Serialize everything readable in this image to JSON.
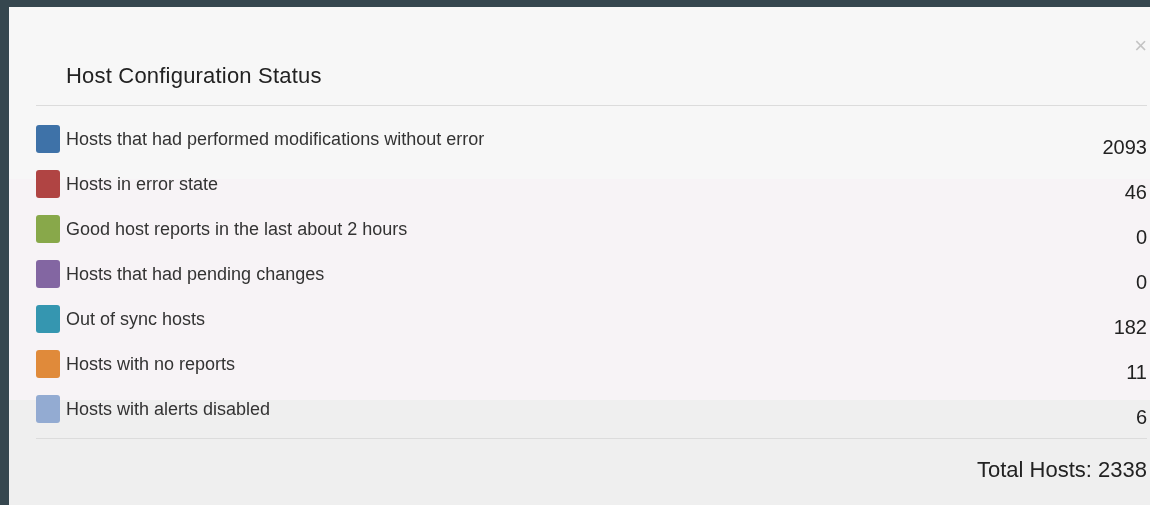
{
  "dialog": {
    "title": "Host Configuration Status",
    "close": "×"
  },
  "items": [
    {
      "label": "Hosts that had performed modifications without error",
      "count": "2093",
      "color": "#3e72a8"
    },
    {
      "label": "Hosts in error state",
      "count": "46",
      "color": "#b04443"
    },
    {
      "label": "Good host reports in the last about 2 hours",
      "count": "0",
      "color": "#88a84a"
    },
    {
      "label": "Hosts that had pending changes",
      "count": "0",
      "color": "#8366a2"
    },
    {
      "label": "Out of sync hosts",
      "count": "182",
      "color": "#3596b0"
    },
    {
      "label": "Hosts with no reports",
      "count": "11",
      "color": "#e08a3a"
    },
    {
      "label": "Hosts with alerts disabled",
      "count": "6",
      "color": "#93abd2"
    }
  ],
  "total": "Total Hosts: 2338"
}
